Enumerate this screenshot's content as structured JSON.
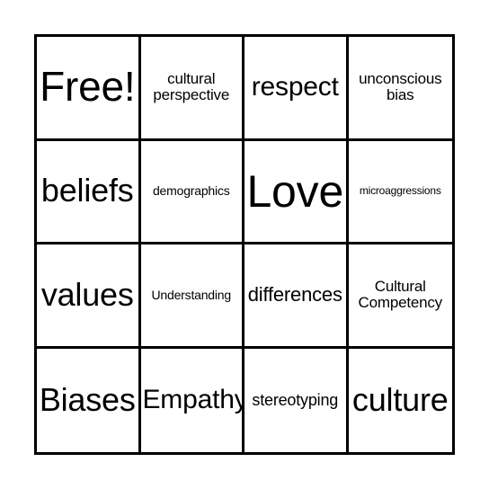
{
  "card": {
    "type": "bingo-card",
    "columns": 4,
    "rows": 4,
    "background_color": "#ffffff",
    "border_color": "#000000",
    "text_color": "#000000",
    "cells": [
      {
        "text": "Free!",
        "size": "fs-free",
        "lines": 1,
        "free_space": true
      },
      {
        "text": "cultural\nperspective",
        "size": "fs-xxs",
        "lines": 2,
        "free_space": false
      },
      {
        "text": "respect",
        "size": "fs-md",
        "lines": 1,
        "free_space": false
      },
      {
        "text": "unconscious\nbias",
        "size": "fs-xxs",
        "lines": 2,
        "free_space": false
      },
      {
        "text": "beliefs",
        "size": "fs-lg",
        "lines": 1,
        "free_space": false
      },
      {
        "text": "demographics",
        "size": "fs-tiny",
        "lines": 1,
        "free_space": false
      },
      {
        "text": "Love",
        "size": "fs-xl",
        "lines": 1,
        "free_space": false
      },
      {
        "text": "microaggressions",
        "size": "fs-micro",
        "lines": 1,
        "free_space": false
      },
      {
        "text": "values",
        "size": "fs-lg",
        "lines": 1,
        "free_space": false
      },
      {
        "text": "Understanding",
        "size": "fs-tiny",
        "lines": 1,
        "free_space": false
      },
      {
        "text": "differences",
        "size": "fs-sm",
        "lines": 1,
        "free_space": false
      },
      {
        "text": "Cultural\nCompetency",
        "size": "fs-xxs",
        "lines": 2,
        "free_space": false
      },
      {
        "text": "Biases",
        "size": "fs-lg",
        "lines": 1,
        "free_space": false
      },
      {
        "text": "Empathy",
        "size": "fs-md",
        "lines": 1,
        "free_space": false
      },
      {
        "text": "stereotyping",
        "size": "fs-xs",
        "lines": 1,
        "free_space": false
      },
      {
        "text": "culture",
        "size": "fs-lg",
        "lines": 1,
        "free_space": false
      }
    ]
  }
}
